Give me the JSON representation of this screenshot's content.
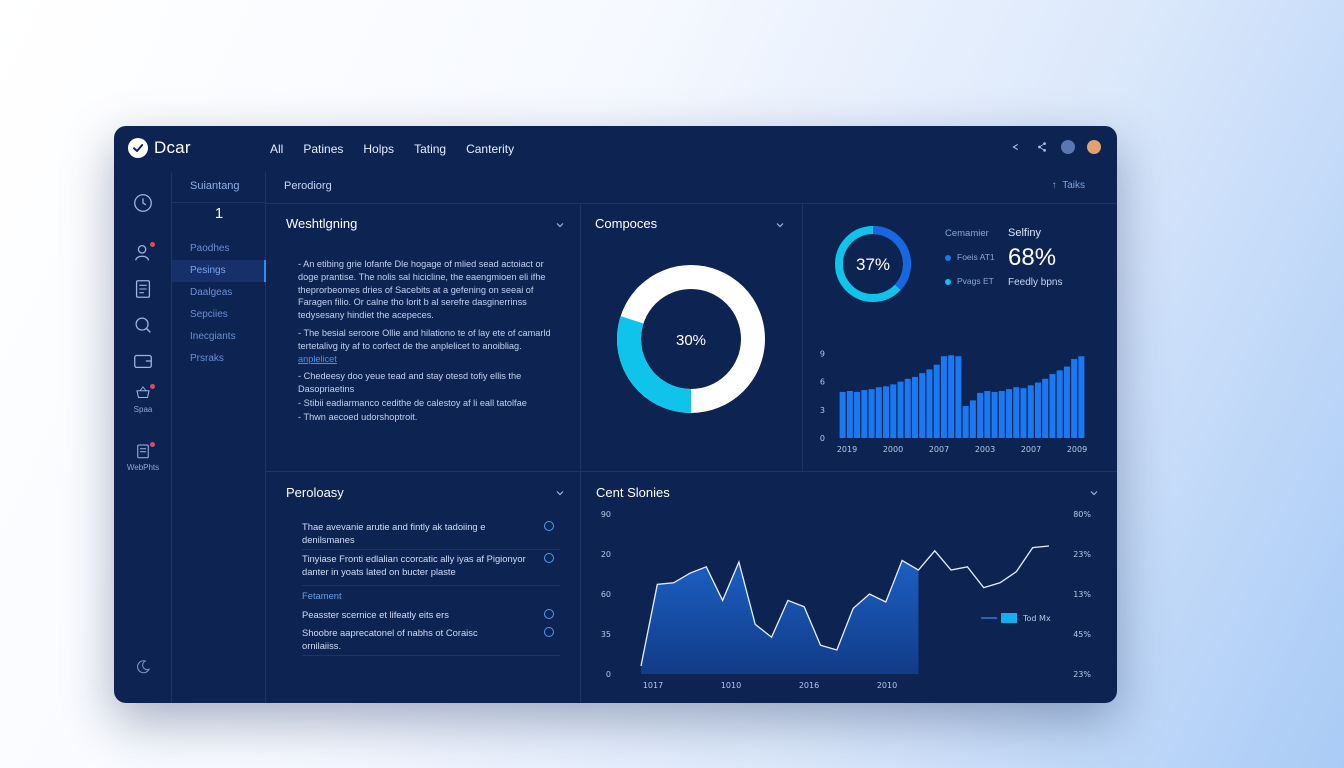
{
  "app": {
    "name": "Dcar",
    "nav": [
      "All",
      "Patines",
      "Holps",
      "Tating",
      "Canterity"
    ]
  },
  "colors": {
    "accent": "#1a78f0",
    "cyan": "#10c3ea",
    "window_bg": "#0d2352",
    "ring_track": "#ffffff"
  },
  "rail": [
    {
      "icon": "clock-icon",
      "label": ""
    },
    {
      "icon": "user-icon",
      "label": ""
    },
    {
      "icon": "document-icon",
      "label": ""
    },
    {
      "icon": "search-icon",
      "label": ""
    },
    {
      "icon": "wallet-icon",
      "label": ""
    },
    {
      "icon": "basket-icon",
      "label": "Spaa"
    },
    {
      "icon": "clipboard-icon",
      "label": "WebPhts"
    },
    {
      "icon": "moon-icon",
      "label": ""
    }
  ],
  "subnav": {
    "heading": "Suiantang",
    "count": "1",
    "items": [
      "Paodhes",
      "Pesings",
      "Daalgeas",
      "Sepciies",
      "Inecgiants",
      "Prsraks"
    ]
  },
  "content": {
    "title": "Perodiorg",
    "action": "Taiks"
  },
  "panel_text": {
    "title": "Weshtlgning",
    "bullets": [
      "An etibing grie lofanfe Dle hogage of mlied sead actoiact or doge prantise. The nolis sal hicicline, the eaengmioen eli ifhe theprorbeomes dries of Sacebits at a gefening on seeai of Faragen filio. Or calne tho lorit b al serefre dasginerrinss tedysesany hindiet the acepeces.",
      "The besial seroore Ollie and hilationo te of lay ete of camarld tertetalivg ity af to corfect de the anplelicet to anoibliag.",
      "Chedeesy doo yeue tead and stay otesd tofiy ellis the Dasopriaetins",
      "Stibii eadiarmanco cedithe de calestoy af li eall tatolfae",
      "Thwn aecoed udorshoptroit."
    ],
    "bullet_link": "anplelicet"
  },
  "panel_donut": {
    "title": "Compoces",
    "percent_label": "30%",
    "value_pct": 30,
    "ring_color": "#10c3ea"
  },
  "panel_stats": {
    "ring_label": "37%",
    "ring_value_pct": 37,
    "legend_title": "Cemamier",
    "legend_items": [
      {
        "label": "Foeis AT1",
        "color": "#1a78f0"
      },
      {
        "label": "Pvags ET",
        "color": "#10c3ea"
      }
    ],
    "stat_title": "Selfiny",
    "stat_value": "68%",
    "stat_caption": "Feedly bpns"
  },
  "panel_list": {
    "title": "Peroloasy",
    "rows": [
      "Thae avevanie arutie and fintly ak tadoiing e denilsmanes",
      "Tinyiase Fronti edlalian ccorcatic ally iyas af Pigionyor danter in yoats lated on bucter plaste"
    ],
    "subheading": "Fetament",
    "rows2": [
      "Peasster scernice et lifeatly eits ers",
      "Shoobre aaprecatonel of nabhs ot Coraisc ornilaiiss."
    ]
  },
  "panel_area": {
    "title": "Cent Slonies",
    "legend": "Tod Mx"
  },
  "chart_data": [
    {
      "type": "bar",
      "y_ticks": [
        "0",
        "3",
        "6",
        "9"
      ],
      "ylim": [
        0,
        10
      ],
      "x_ticks": [
        "2019",
        "2000",
        "2007",
        "2003",
        "2007",
        "2009"
      ],
      "values": [
        4.9,
        5.0,
        4.9,
        5.1,
        5.2,
        5.4,
        5.5,
        5.7,
        6.0,
        6.3,
        6.5,
        6.9,
        7.3,
        7.8,
        8.7,
        8.8,
        8.7,
        3.4,
        4.0,
        4.8,
        5.0,
        4.9,
        5.0,
        5.2,
        5.4,
        5.3,
        5.6,
        5.9,
        6.3,
        6.8,
        7.2,
        7.6,
        8.4,
        8.7
      ],
      "bar_color": "#1a78f0"
    },
    {
      "type": "area",
      "y_ticks_left": [
        "0",
        "35",
        "60",
        "20",
        "90"
      ],
      "y_ticks_right": [
        "23%",
        "45%",
        "13%",
        "23%",
        "80%"
      ],
      "x_ticks": [
        "1017",
        "1010",
        "2016",
        "2010"
      ],
      "ylim": [
        0,
        100
      ],
      "values": [
        5,
        56,
        57,
        63,
        67,
        46,
        70,
        31,
        23,
        46,
        42,
        18,
        15,
        41,
        50,
        45,
        71,
        65,
        77,
        65,
        67,
        54,
        57,
        64,
        79,
        80
      ],
      "filled_points": 17,
      "color": "#1a5fc4"
    }
  ]
}
